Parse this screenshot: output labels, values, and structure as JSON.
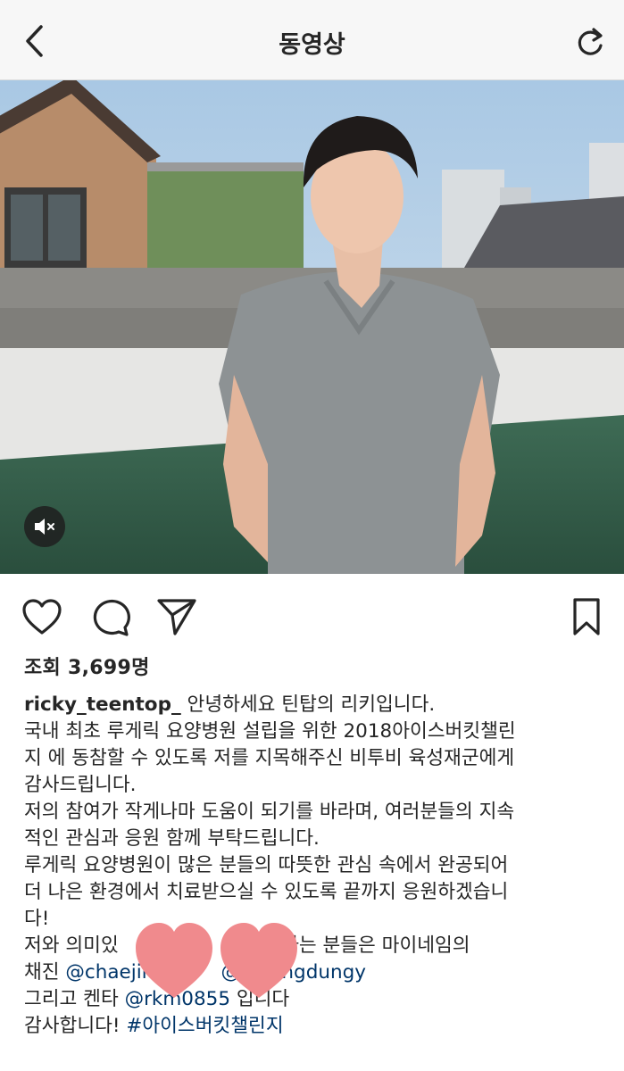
{
  "header": {
    "title": "동영상",
    "back_icon": "chevron-left-icon",
    "refresh_icon": "refresh-icon"
  },
  "video": {
    "muted": true,
    "mute_icon": "speaker-muted-icon"
  },
  "actions": {
    "like_icon": "heart-icon",
    "comment_icon": "comment-icon",
    "share_icon": "paper-plane-icon",
    "save_icon": "bookmark-icon"
  },
  "views": "조회 3,699명",
  "caption": {
    "username": "ricky_teentop_",
    "line1_text": " 안녕하세요 틴탑의 리키입니다.",
    "line2": "국내 최초 루게릭 요양병원 설립을 위한 2018아이스버킷챌린",
    "line3": "지 에 동참할 수 있도록 저를 지목해주신 비투비 육성재군에게",
    "line4": "감사드립니다.",
    "line5": "저의 참여가 작게나마 도움이 되기를 바라며, 여러분들의 지속",
    "line6": "적인 관심과 응원 함께 부탁드립니다.",
    "line7": "루게릭 요양병원이 많은 분들의 따뜻한 관심 속에서 완공되어",
    "line8": "더 나은 환경에서 치료받으실 수 있도록 끝까지 응원하겠습니",
    "line9": "다!",
    "line10": "저와 의미있                 했으면 하는 분들은 마이네임의",
    "line11_prefix": "채진 ",
    "mention1": "@chaejin",
    "line11_mid": "           ",
    "mention2": "@sarangdungy",
    "line12_prefix": "그리고 켄타 ",
    "mention3": "@rkm0855",
    "line12_suffix": " 입니다",
    "line13_prefix": "감사합니다! ",
    "hashtag": "#아이스버킷챌린지"
  },
  "colors": {
    "link": "#003569",
    "text": "#262626",
    "navbar_bg": "#f7f7f7",
    "heart_sticker": "#f08a8d"
  }
}
